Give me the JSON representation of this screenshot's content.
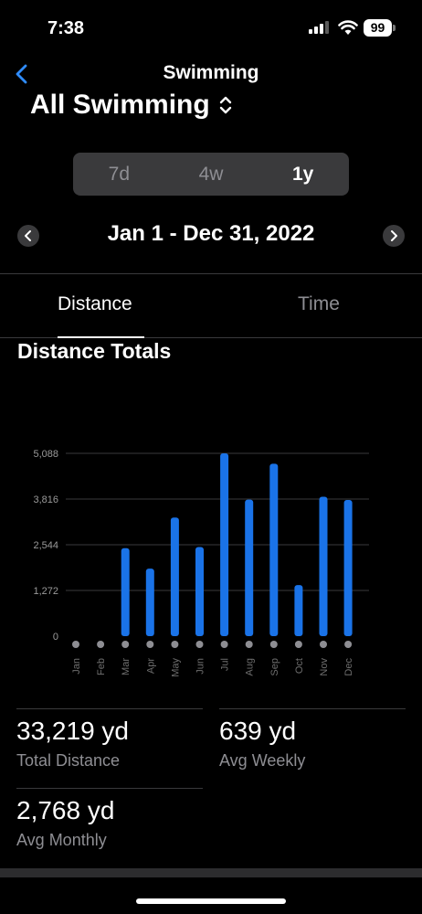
{
  "status": {
    "time": "7:38",
    "battery": "99"
  },
  "nav": {
    "title": "Swimming"
  },
  "workout_type": "All Swimming",
  "segments": [
    {
      "label": "7d",
      "active": false
    },
    {
      "label": "4w",
      "active": false
    },
    {
      "label": "1y",
      "active": true
    }
  ],
  "date_range": "Jan 1 - Dec 31, 2022",
  "tabs": {
    "distance": "Distance",
    "time": "Time"
  },
  "section_title": "Distance Totals",
  "chart_data": {
    "type": "bar",
    "categories": [
      "Jan",
      "Feb",
      "Mar",
      "Apr",
      "May",
      "Jun",
      "Jul",
      "Aug",
      "Sep",
      "Oct",
      "Nov",
      "Dec"
    ],
    "values": [
      0,
      0,
      2450,
      1880,
      3300,
      2480,
      5088,
      3800,
      4800,
      1420,
      3880,
      3790
    ],
    "yticks": [
      "0",
      "1,272",
      "2,544",
      "3,816",
      "5,088"
    ],
    "ytick_values": [
      0,
      1272,
      2544,
      3816,
      5088
    ],
    "ylim": [
      0,
      5088
    ],
    "grid": true,
    "bar_color": "#1a73e8"
  },
  "stats": {
    "total": {
      "value": "33,219 yd",
      "label": "Total Distance"
    },
    "weekly": {
      "value": "639 yd",
      "label": "Avg Weekly"
    },
    "monthly": {
      "value": "2,768 yd",
      "label": "Avg Monthly"
    }
  }
}
